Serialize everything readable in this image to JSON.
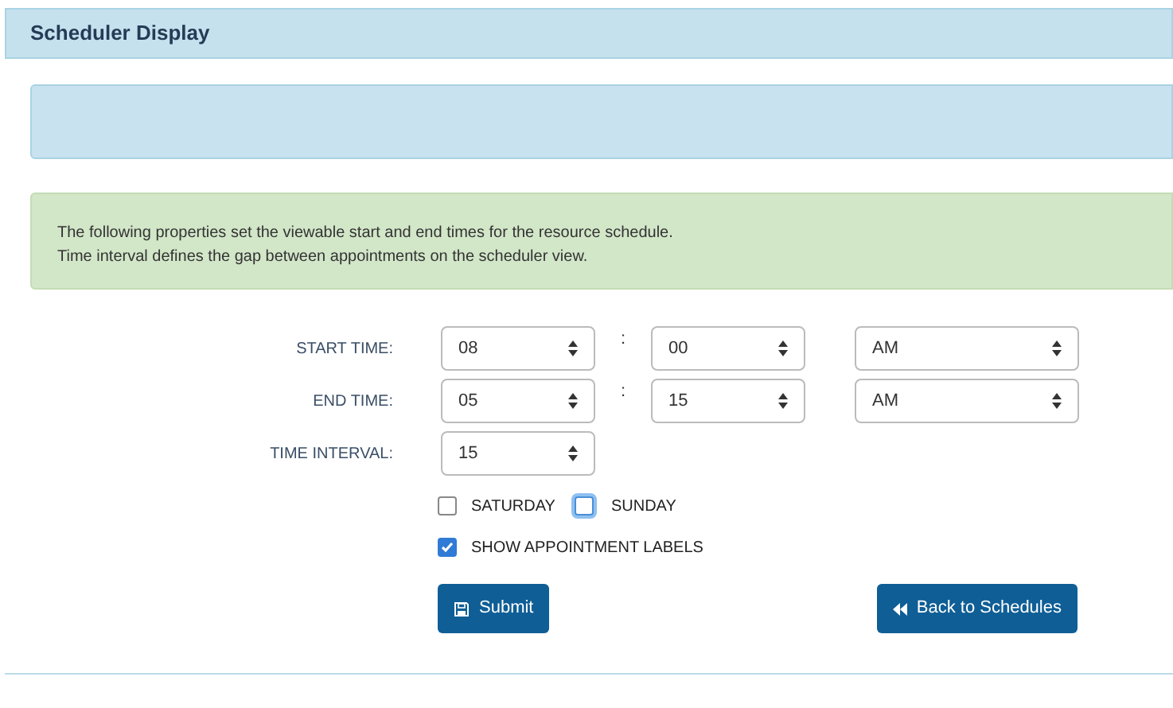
{
  "panel": {
    "title": "Scheduler Display"
  },
  "info_lines": [
    "The following properties set the viewable start and end times for the resource schedule.",
    "Time interval defines the gap between appointments on the scheduler view."
  ],
  "time_rows": [
    {
      "label": "START TIME:",
      "hour": "08",
      "separator": ":",
      "minute": "00",
      "period": "AM"
    },
    {
      "label": "END TIME:",
      "hour": "05",
      "separator": ":",
      "minute": "15",
      "period": "AM"
    }
  ],
  "interval": {
    "label": "TIME INTERVAL:",
    "value": "15"
  },
  "day_checkboxes": [
    {
      "label": "SATURDAY",
      "checked": false,
      "focused": false
    },
    {
      "label": "SUNDAY",
      "checked": false,
      "focused": true
    }
  ],
  "labels_checkbox": {
    "label": "SHOW APPOINTMENT LABELS",
    "checked": true
  },
  "buttons": [
    {
      "kind": "submit",
      "label": "Submit"
    },
    {
      "kind": "back",
      "label": "Back to Schedules"
    }
  ]
}
